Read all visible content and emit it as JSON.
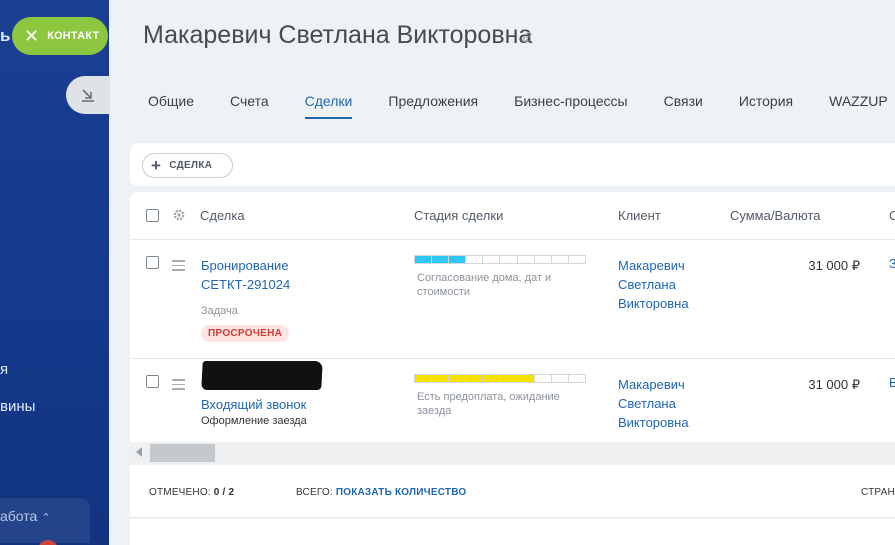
{
  "window": {
    "title": "Макаревич Светлана Викторовна"
  },
  "sidebar": {
    "fragment_top": "ь",
    "fragment_a": "я",
    "fragment_b": "вины",
    "work_label": "абота"
  },
  "header": {
    "contact_button": "КОНТАКТ",
    "title": "Макаревич Светлана Викторовна"
  },
  "tabs": [
    {
      "label": "Общие",
      "active": false
    },
    {
      "label": "Счета",
      "active": false
    },
    {
      "label": "Сделки",
      "active": true
    },
    {
      "label": "Предложения",
      "active": false
    },
    {
      "label": "Бизнес-процессы",
      "active": false
    },
    {
      "label": "Связи",
      "active": false
    },
    {
      "label": "История",
      "active": false
    },
    {
      "label": "WAZZUP",
      "active": false
    }
  ],
  "toolbar": {
    "add_deal_label": "СДЕЛКА"
  },
  "grid": {
    "columns": [
      "Сделка",
      "Стадия сделки",
      "Клиент",
      "Сумма/Валюта",
      "С"
    ],
    "rows": [
      {
        "deal": "Бронирование СЕТКТ-291024",
        "task_label": "Задача",
        "badge": "ПРОСРОЧЕНА",
        "stage_label": "Согласование дома, дат и стоимости",
        "stage_filled": 3,
        "stage_total": 10,
        "stage_color": "#2fc6f6",
        "client": "Макаревич Светлана Викторовна",
        "sum": "31 000 ₽",
        "edge": "З"
      },
      {
        "deal": "Входящий звонок",
        "subtitle": "Оформление заезда",
        "stage_label": "Есть предоплата, ожидание заезда",
        "stage_filled": 7,
        "stage_total": 10,
        "stage_color": "#f5e100",
        "client": "Макаревич Светлана Викторовна",
        "sum": "31 000 ₽",
        "edge": "В"
      }
    ]
  },
  "footer": {
    "marked_label": "ОТМЕЧЕНО:",
    "marked_value": "0 / 2",
    "total_label": "ВСЕГО:",
    "total_link": "ПОКАЗАТЬ КОЛИЧЕСТВО",
    "page_label": "СТРАН"
  },
  "colors": {
    "accent": "#2067b0",
    "sidebar": "#1b3f93",
    "contact_green": "#8cc73f",
    "overdue_red": "#d03b34"
  }
}
